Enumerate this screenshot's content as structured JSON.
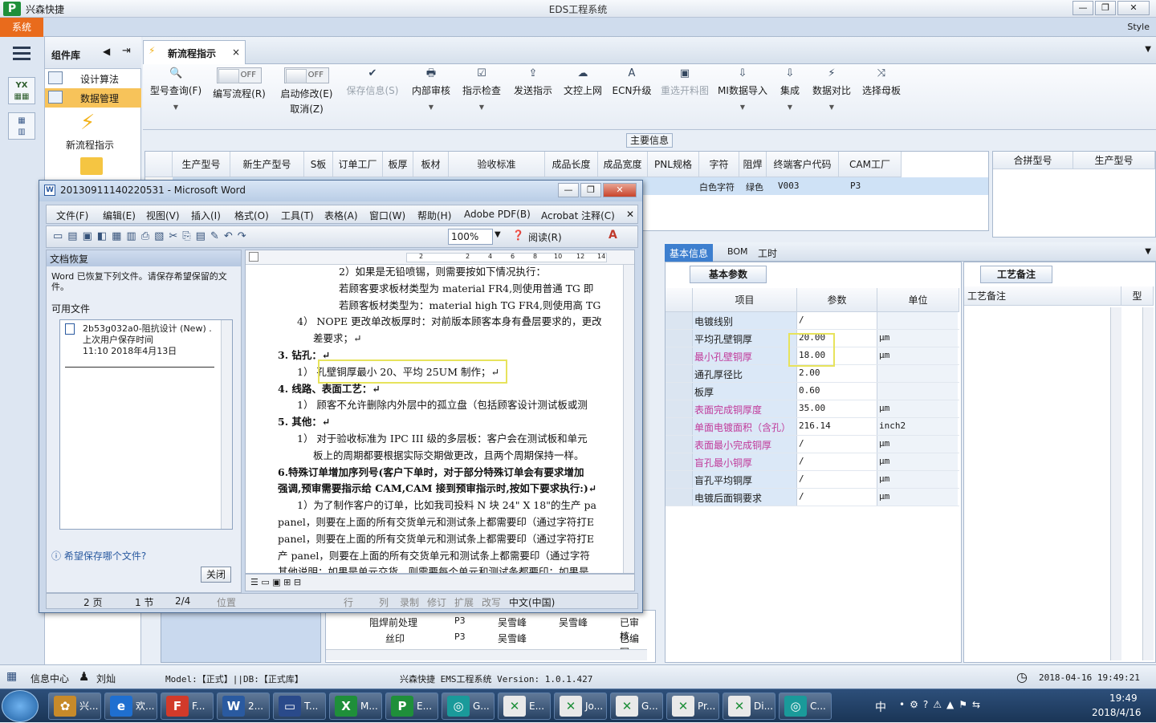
{
  "app": {
    "name": "兴森快捷",
    "window_title": "EDS工程系统",
    "system_btn": "系统",
    "style_label": "Style",
    "win_min": "—",
    "win_max": "❐",
    "win_close": "✕"
  },
  "leftrail": {
    "yx": "YX",
    "yx_sub": "▦▦"
  },
  "components": {
    "title": "组件库",
    "items": [
      {
        "label": "设计算法"
      },
      {
        "label": "数据管理"
      }
    ],
    "flow": "新流程指示"
  },
  "tab": {
    "label": "新流程指示",
    "close": "×"
  },
  "ribbon": [
    {
      "label": "型号查询(F)",
      "icon": "🔍"
    },
    {
      "label": "编写流程(R)",
      "toggle": "OFF"
    },
    {
      "label": "启动修改(E)",
      "label2": "取消(Z)",
      "toggle": "OFF"
    },
    {
      "label": "保存信息(S)",
      "icon": "✔"
    },
    {
      "label": "内部审核",
      "icon": "🖶"
    },
    {
      "label": "指示检查",
      "icon": "☑"
    },
    {
      "label": "发送指示",
      "icon": "⇪"
    },
    {
      "label": "文控上网",
      "icon": "☁"
    },
    {
      "label": "ECN升级",
      "icon": "A"
    },
    {
      "label": "重选开料图",
      "icon": "▣"
    },
    {
      "label": "MI数据导入",
      "icon": "⇩"
    },
    {
      "label": "集成",
      "icon": "⇩"
    },
    {
      "label": "数据对比",
      "icon": "⚡"
    },
    {
      "label": "选择母板",
      "icon": "⤨"
    }
  ],
  "main_info": "主要信息",
  "grid": {
    "headers": [
      "生产型号",
      "新生产型号",
      "S板",
      "订单工厂",
      "板厚",
      "板材",
      "验收标准",
      "成品长度",
      "成品宽度",
      "PNL规格",
      "字符",
      "阻焊",
      "终端客户代码",
      "CAM工厂"
    ],
    "row": {
      "char": "白色字符",
      "mask": "绿色",
      "customer": "V003",
      "cam": "P3"
    },
    "right_headers": [
      "合拼型号",
      "生产型号"
    ]
  },
  "lower_list": [
    {
      "name": "阻焊前处理",
      "fac": "P3",
      "a": "吴雪峰",
      "b": "吴雪峰",
      "status": "已审核"
    },
    {
      "name": "丝印",
      "fac": "P3",
      "a": "吴雪峰",
      "b": "",
      "status": "已编写"
    }
  ],
  "panel_tabs": [
    "基本信息",
    "BOM",
    "工时"
  ],
  "basic": {
    "tab": "基本参数",
    "headers": [
      "项目",
      "参数",
      "单位"
    ],
    "rows": [
      {
        "k": "电镀线别",
        "v": "/",
        "u": "",
        "pink": false
      },
      {
        "k": "平均孔壁铜厚",
        "v": "20.00",
        "u": "μm",
        "pink": false
      },
      {
        "k": "最小孔壁铜厚",
        "v": "18.00",
        "u": "μm",
        "pink": true
      },
      {
        "k": "通孔厚径比",
        "v": "2.00",
        "u": "",
        "pink": false
      },
      {
        "k": "板厚",
        "v": "0.60",
        "u": "",
        "pink": false
      },
      {
        "k": "表面完成铜厚度",
        "v": "35.00",
        "u": "μm",
        "pink": true
      },
      {
        "k": "单面电镀面积（含孔）",
        "v": "216.14",
        "u": "inch2",
        "pink": true
      },
      {
        "k": "表面最小完成铜厚",
        "v": "/",
        "u": "μm",
        "pink": true
      },
      {
        "k": "盲孔最小铜厚",
        "v": "/",
        "u": "μm",
        "pink": true
      },
      {
        "k": "盲孔平均铜厚",
        "v": "/",
        "u": "μm",
        "pink": false
      },
      {
        "k": "电镀后面铜要求",
        "v": "/",
        "u": "μm",
        "pink": false
      }
    ]
  },
  "notes": {
    "tab": "工艺备注",
    "header": "工艺备注",
    "header2": "型"
  },
  "word": {
    "title": "20130911140220531 - Microsoft Word",
    "menu": [
      "文件(F)",
      "编辑(E)",
      "视图(V)",
      "插入(I)",
      "格式(O)",
      "工具(T)",
      "表格(A)",
      "窗口(W)",
      "帮助(H)",
      "Adobe PDF(B)",
      "Acrobat 注释(C)"
    ],
    "zoom": "100%",
    "read": "阅读(R)",
    "recovery": {
      "title": "文档恢复",
      "desc": "Word 已恢复下列文件。请保存希望保留的文件。",
      "available": "可用文件",
      "file_name": "2b53g032a0-阻抗设计 (New) .",
      "file_note": "上次用户保存时间",
      "file_time": "11:10 2018年4月13日",
      "help": "希望保存哪个文件?",
      "close": "关闭"
    },
    "ruler": [
      "2",
      "2",
      "4",
      "6",
      "8",
      "10",
      "12",
      "14"
    ],
    "lines": [
      {
        "t": "2）如果是无铅喷锡，则需要按如下情况执行：",
        "b": false
      },
      {
        "t": "若顾客要求板材类型为 material FR4,则使用普通 TG 即",
        "b": false
      },
      {
        "t": "若顾客板材类型为：material high TG FR4,则使用高 TG",
        "b": false
      },
      {
        "t": "4） NOPE 更改单改板厚时：对前版本顾客本身有叠层要求的，更改",
        "b": false
      },
      {
        "t": "差要求；↵",
        "b": false
      },
      {
        "t": "3.  钻孔：↵",
        "b": true
      },
      {
        "t": "1） 孔壁铜厚最小 20、平均 25UM 制作；↵",
        "b": false
      },
      {
        "t": "4.  线路、表面工艺：↵",
        "b": true
      },
      {
        "t": "1） 顾客不允许删除内外层中的孤立盘（包括顾客设计测试板或测",
        "b": false
      },
      {
        "t": "5.  其他：↵",
        "b": true
      },
      {
        "t": "1） 对于验收标准为 IPC III 级的多层板：客户会在测试板和单元",
        "b": false
      },
      {
        "t": "板上的周期都要根据实际交期做更改，且两个周期保持一样。",
        "b": false
      },
      {
        "t": "6.特殊订单增加序列号(客户下单时，对于部分特殊订单会有要求增加",
        "b": true
      },
      {
        "t": "强调,预审需要指示给 CAM,CAM 接到预审指示时,按如下要求执行:)↵",
        "b": true
      },
      {
        "t": "1）为了制作客户的订单，比如我司投料 N 块 24\" X 18\"的生产 pa",
        "b": false
      },
      {
        "t": "panel，则要在上面的所有交货单元和测试条上都需要印（通过字符打E",
        "b": false
      },
      {
        "t": "panel，则要在上面的所有交货单元和测试条上都需要印（通过字符打E",
        "b": false
      },
      {
        "t": "产 panel，则要在上面的所有交货单元和测试条上都需要印（通过字符",
        "b": false
      },
      {
        "t": "其他说明：如果是单元交货，则需要每个单元和测试条都要印；如果是",
        "b": false
      },
      {
        "t": "要在下某边印，一个就可以了。如果这个 set 没有下某边，则可在任意",
        "b": false
      }
    ],
    "status": [
      "2 页",
      "1 节",
      "2/4",
      "位置",
      "行",
      "列",
      "录制",
      "修订",
      "扩展",
      "改写",
      "中文(中国)"
    ]
  },
  "statusbar": {
    "info": "信息中心",
    "user": "刘灿",
    "model": "Model:【正式】||DB:【正式库】",
    "version": "兴森快捷 EMS工程系统 Version: 1.0.1.427",
    "datetime": "2018-04-16 19:49:21"
  },
  "taskbar": {
    "items": [
      "兴...",
      "欢...",
      "F...",
      "2...",
      "T...",
      "M...",
      "E...",
      "G...",
      "E...",
      "Jo...",
      "G...",
      "Pr...",
      "Di...",
      "C..."
    ],
    "time": "19:49",
    "date": "2018/4/16",
    "ime": "中"
  },
  "colors": {
    "accent": "#3d7fcf",
    "system": "#e96b1c",
    "highlight": "#e7e35c",
    "pink": "#c03a9a"
  }
}
